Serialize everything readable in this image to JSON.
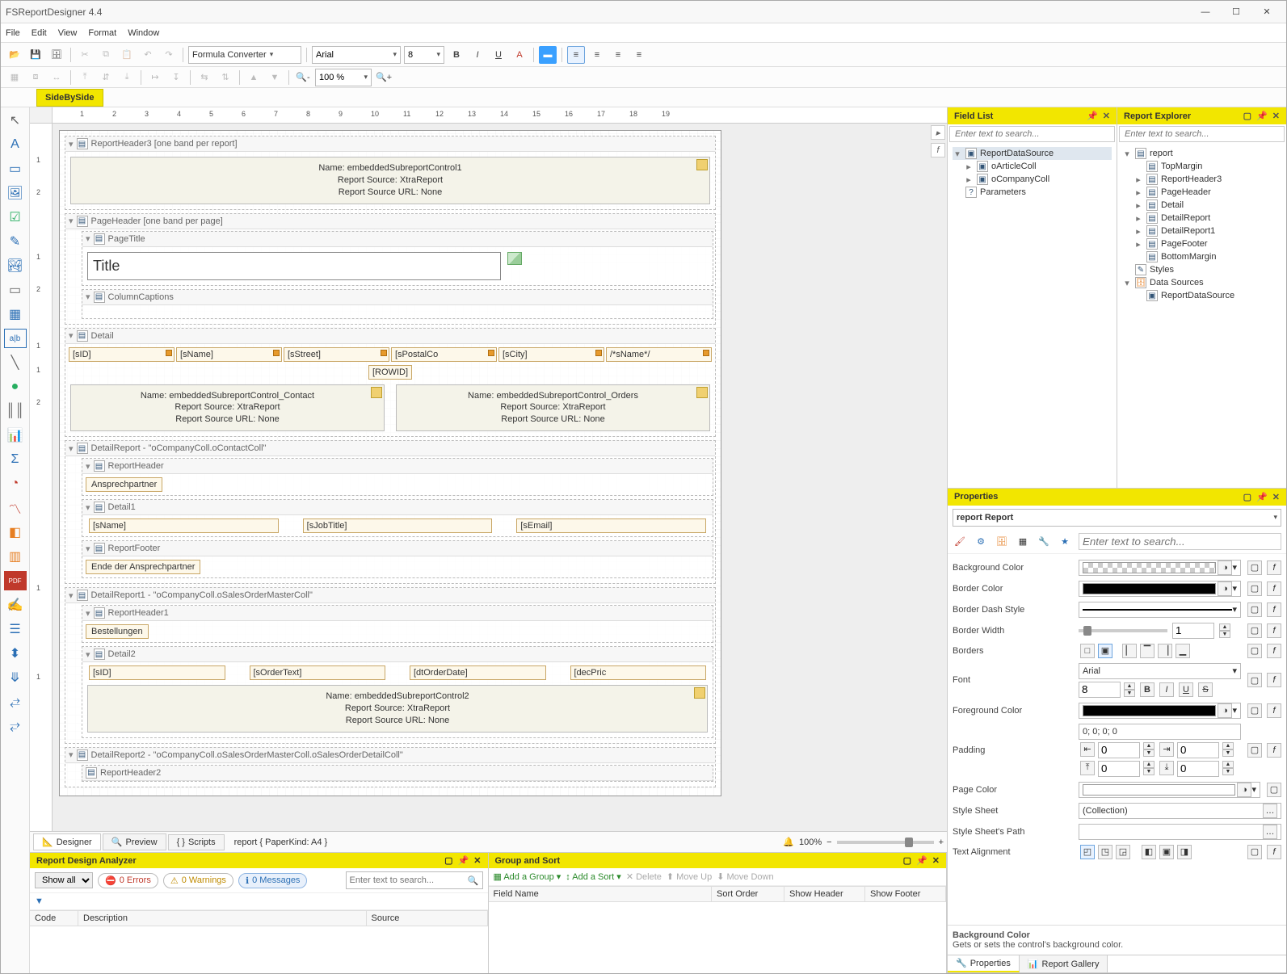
{
  "app_title": "FSReportDesigner 4.4",
  "menus": [
    "File",
    "Edit",
    "View",
    "Format",
    "Window"
  ],
  "toolbar": {
    "formula_converter": "Formula Converter",
    "font_name": "Arial",
    "font_size": "8",
    "zoom": "100 %"
  },
  "side_tab": "SideBySide",
  "ruler_top": [
    "1",
    "2",
    "3",
    "4",
    "5",
    "6",
    "7",
    "8",
    "9",
    "10",
    "11",
    "12",
    "13",
    "14",
    "15",
    "16",
    "17",
    "18",
    "19"
  ],
  "ruler_left": [
    "1",
    "2",
    "1",
    "2",
    "1",
    "1",
    "2",
    "1",
    "1"
  ],
  "bands": {
    "report_header3": {
      "name": "ReportHeader3 [one band per report]",
      "sub_name": "Name: embeddedSubreportControl1",
      "sub_src": "Report Source: XtraReport",
      "sub_url": "Report Source URL: None"
    },
    "page_header": {
      "name": "PageHeader [one band per page]",
      "page_title_band": "PageTitle",
      "title_text": "Title",
      "column_captions": "ColumnCaptions"
    },
    "detail": {
      "name": "Detail",
      "fields": [
        "[sID]",
        "[sName]",
        "[sStreet]",
        "[sPostalCo",
        "[sCity]",
        "/*sName*/"
      ],
      "rowid": "[ROWID]",
      "sub_contact": {
        "name": "Name: embeddedSubreportControl_Contact",
        "src": "Report Source: XtraReport",
        "url": "Report Source URL: None"
      },
      "sub_orders": {
        "name": "Name: embeddedSubreportControl_Orders",
        "src": "Report Source: XtraReport",
        "url": "Report Source URL: None"
      }
    },
    "detail_report": {
      "name": "DetailReport - \"oCompanyColl.oContactColl\"",
      "rh": "ReportHeader",
      "rh_label": "Ansprechpartner",
      "d1": "Detail1",
      "d1_fields": [
        "[sName]",
        "[sJobTitle]",
        "[sEmail]"
      ],
      "rf": "ReportFooter",
      "rf_label": "Ende der Ansprechpartner"
    },
    "detail_report1": {
      "name": "DetailReport1 - \"oCompanyColl.oSalesOrderMasterColl\"",
      "rh1": "ReportHeader1",
      "rh1_label": "Bestellungen",
      "d2": "Detail2",
      "d2_fields": [
        "[sID]",
        "[sOrderText]",
        "[dtOrderDate]",
        "[decPric"
      ],
      "sub2": {
        "name": "Name: embeddedSubreportControl2",
        "src": "Report Source: XtraReport",
        "url": "Report Source URL: None"
      }
    },
    "detail_report2": {
      "name": "DetailReport2 - \"oCompanyColl.oSalesOrderMasterColl.oSalesOrderDetailColl\"",
      "rh2": "ReportHeader2"
    }
  },
  "view_tabs": {
    "designer": "Designer",
    "preview": "Preview",
    "scripts": "Scripts",
    "report_label": "report { PaperKind: A4 }"
  },
  "status": {
    "zoom": "100%"
  },
  "analyzer": {
    "title": "Report Design Analyzer",
    "show_all": "Show all",
    "errors": "0 Errors",
    "warnings": "0 Warnings",
    "messages": "0 Messages",
    "search_ph": "Enter text to search...",
    "cols": {
      "code": "Code",
      "desc": "Description",
      "source": "Source"
    }
  },
  "group_sort": {
    "title": "Group and Sort",
    "add_group": "Add a Group",
    "add_sort": "Add a Sort",
    "delete": "Delete",
    "move_up": "Move Up",
    "move_down": "Move Down",
    "cols": {
      "field": "Field Name",
      "order": "Sort Order",
      "show_hdr": "Show Header",
      "show_ftr": "Show Footer"
    }
  },
  "field_list": {
    "title": "Field List",
    "search_ph": "Enter text to search...",
    "root": "ReportDataSource",
    "children": [
      "oArticleColl",
      "oCompanyColl"
    ],
    "params": "Parameters"
  },
  "report_explorer": {
    "title": "Report Explorer",
    "search_ph": "Enter text to search...",
    "root": "report",
    "nodes": [
      "TopMargin",
      "ReportHeader3",
      "PageHeader",
      "Detail",
      "DetailReport",
      "DetailReport1",
      "PageFooter",
      "BottomMargin"
    ],
    "styles": "Styles",
    "ds": "Data Sources",
    "ds_child": "ReportDataSource"
  },
  "properties": {
    "title": "Properties",
    "target": "report   Report",
    "search_ph": "Enter text to search...",
    "labels": {
      "bg": "Background Color",
      "bcolor": "Border Color",
      "bdash": "Border Dash Style",
      "bwidth": "Border Width",
      "borders": "Borders",
      "font": "Font",
      "fg": "Foreground Color",
      "padding": "Padding",
      "pagecolor": "Page Color",
      "stylesheet": "Style Sheet",
      "stylepath": "Style Sheet's Path",
      "textalign": "Text Alignment"
    },
    "values": {
      "bwidth": "1",
      "font_name": "Arial",
      "font_size": "8",
      "padding": "0; 0; 0; 0",
      "pad_l": "0",
      "pad_r": "0",
      "pad_t": "0",
      "pad_b": "0",
      "stylesheet": "(Collection)"
    },
    "desc_title": "Background Color",
    "desc_text": "Gets or sets the control's background color."
  },
  "bottom_prop_tabs": {
    "props": "Properties",
    "gallery": "Report Gallery"
  }
}
